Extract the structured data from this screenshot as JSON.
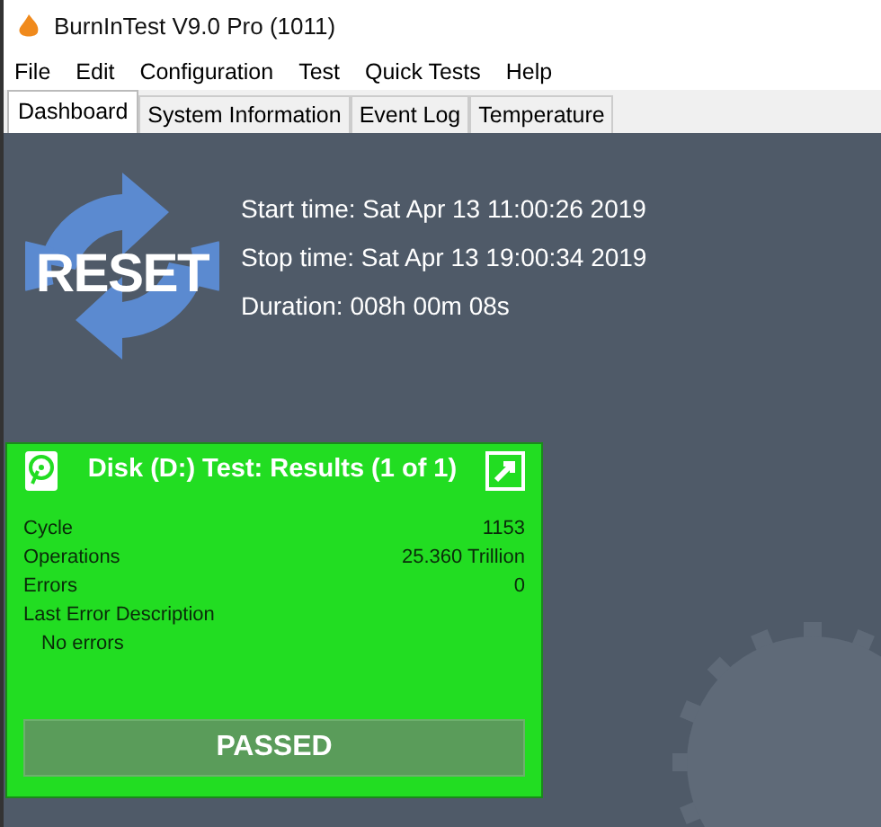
{
  "window": {
    "title": "BurnInTest V9.0 Pro (1011)"
  },
  "menu": [
    "File",
    "Edit",
    "Configuration",
    "Test",
    "Quick Tests",
    "Help"
  ],
  "tabs": [
    {
      "label": "Dashboard",
      "selected": true
    },
    {
      "label": "System Information",
      "selected": false
    },
    {
      "label": "Event Log",
      "selected": false
    },
    {
      "label": "Temperature",
      "selected": false
    }
  ],
  "reset": {
    "label": "RESET"
  },
  "times": [
    "Start time: Sat Apr 13 11:00:26 2019",
    "Stop time: Sat Apr 13 19:00:34 2019",
    "Duration: 008h 00m 08s"
  ],
  "result_card": {
    "title": "Disk (D:) Test: Results (1 of 1)",
    "stats": [
      {
        "label": "Cycle",
        "value": "1153"
      },
      {
        "label": "Operations",
        "value": "25.360 Trillion"
      },
      {
        "label": "Errors",
        "value": "0"
      }
    ],
    "last_error": {
      "label": "Last Error Description",
      "value": "No errors"
    },
    "status": "PASSED",
    "color": "#22dd22"
  }
}
